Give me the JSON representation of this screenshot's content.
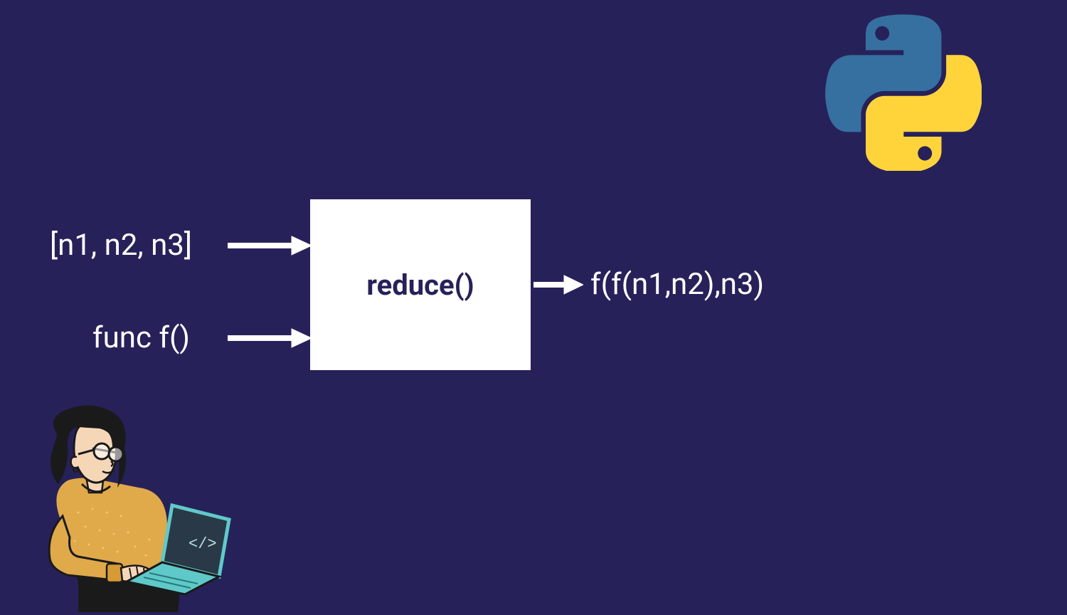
{
  "diagram": {
    "input_list": "[n1, n2, n3]",
    "input_func": "func f()",
    "box_label": "reduce()",
    "output": "f(f(n1,n2),n3)"
  },
  "colors": {
    "background": "#27215a",
    "box_bg": "#ffffff",
    "box_text": "#27215a",
    "text": "#ffffff",
    "python_blue": "#3670a0",
    "python_yellow": "#ffd43b"
  }
}
